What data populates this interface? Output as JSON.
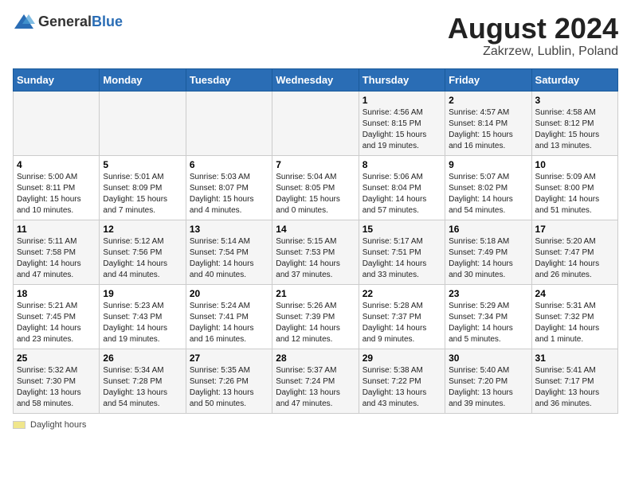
{
  "logo": {
    "general": "General",
    "blue": "Blue"
  },
  "title": "August 2024",
  "subtitle": "Zakrzew, Lublin, Poland",
  "days_of_week": [
    "Sunday",
    "Monday",
    "Tuesday",
    "Wednesday",
    "Thursday",
    "Friday",
    "Saturday"
  ],
  "legend_label": "Daylight hours",
  "weeks": [
    [
      {
        "day": "",
        "sunrise": "",
        "sunset": "",
        "daylight": ""
      },
      {
        "day": "",
        "sunrise": "",
        "sunset": "",
        "daylight": ""
      },
      {
        "day": "",
        "sunrise": "",
        "sunset": "",
        "daylight": ""
      },
      {
        "day": "",
        "sunrise": "",
        "sunset": "",
        "daylight": ""
      },
      {
        "day": "1",
        "sunrise": "Sunrise: 4:56 AM",
        "sunset": "Sunset: 8:15 PM",
        "daylight": "Daylight: 15 hours and 19 minutes."
      },
      {
        "day": "2",
        "sunrise": "Sunrise: 4:57 AM",
        "sunset": "Sunset: 8:14 PM",
        "daylight": "Daylight: 15 hours and 16 minutes."
      },
      {
        "day": "3",
        "sunrise": "Sunrise: 4:58 AM",
        "sunset": "Sunset: 8:12 PM",
        "daylight": "Daylight: 15 hours and 13 minutes."
      }
    ],
    [
      {
        "day": "4",
        "sunrise": "Sunrise: 5:00 AM",
        "sunset": "Sunset: 8:11 PM",
        "daylight": "Daylight: 15 hours and 10 minutes."
      },
      {
        "day": "5",
        "sunrise": "Sunrise: 5:01 AM",
        "sunset": "Sunset: 8:09 PM",
        "daylight": "Daylight: 15 hours and 7 minutes."
      },
      {
        "day": "6",
        "sunrise": "Sunrise: 5:03 AM",
        "sunset": "Sunset: 8:07 PM",
        "daylight": "Daylight: 15 hours and 4 minutes."
      },
      {
        "day": "7",
        "sunrise": "Sunrise: 5:04 AM",
        "sunset": "Sunset: 8:05 PM",
        "daylight": "Daylight: 15 hours and 0 minutes."
      },
      {
        "day": "8",
        "sunrise": "Sunrise: 5:06 AM",
        "sunset": "Sunset: 8:04 PM",
        "daylight": "Daylight: 14 hours and 57 minutes."
      },
      {
        "day": "9",
        "sunrise": "Sunrise: 5:07 AM",
        "sunset": "Sunset: 8:02 PM",
        "daylight": "Daylight: 14 hours and 54 minutes."
      },
      {
        "day": "10",
        "sunrise": "Sunrise: 5:09 AM",
        "sunset": "Sunset: 8:00 PM",
        "daylight": "Daylight: 14 hours and 51 minutes."
      }
    ],
    [
      {
        "day": "11",
        "sunrise": "Sunrise: 5:11 AM",
        "sunset": "Sunset: 7:58 PM",
        "daylight": "Daylight: 14 hours and 47 minutes."
      },
      {
        "day": "12",
        "sunrise": "Sunrise: 5:12 AM",
        "sunset": "Sunset: 7:56 PM",
        "daylight": "Daylight: 14 hours and 44 minutes."
      },
      {
        "day": "13",
        "sunrise": "Sunrise: 5:14 AM",
        "sunset": "Sunset: 7:54 PM",
        "daylight": "Daylight: 14 hours and 40 minutes."
      },
      {
        "day": "14",
        "sunrise": "Sunrise: 5:15 AM",
        "sunset": "Sunset: 7:53 PM",
        "daylight": "Daylight: 14 hours and 37 minutes."
      },
      {
        "day": "15",
        "sunrise": "Sunrise: 5:17 AM",
        "sunset": "Sunset: 7:51 PM",
        "daylight": "Daylight: 14 hours and 33 minutes."
      },
      {
        "day": "16",
        "sunrise": "Sunrise: 5:18 AM",
        "sunset": "Sunset: 7:49 PM",
        "daylight": "Daylight: 14 hours and 30 minutes."
      },
      {
        "day": "17",
        "sunrise": "Sunrise: 5:20 AM",
        "sunset": "Sunset: 7:47 PM",
        "daylight": "Daylight: 14 hours and 26 minutes."
      }
    ],
    [
      {
        "day": "18",
        "sunrise": "Sunrise: 5:21 AM",
        "sunset": "Sunset: 7:45 PM",
        "daylight": "Daylight: 14 hours and 23 minutes."
      },
      {
        "day": "19",
        "sunrise": "Sunrise: 5:23 AM",
        "sunset": "Sunset: 7:43 PM",
        "daylight": "Daylight: 14 hours and 19 minutes."
      },
      {
        "day": "20",
        "sunrise": "Sunrise: 5:24 AM",
        "sunset": "Sunset: 7:41 PM",
        "daylight": "Daylight: 14 hours and 16 minutes."
      },
      {
        "day": "21",
        "sunrise": "Sunrise: 5:26 AM",
        "sunset": "Sunset: 7:39 PM",
        "daylight": "Daylight: 14 hours and 12 minutes."
      },
      {
        "day": "22",
        "sunrise": "Sunrise: 5:28 AM",
        "sunset": "Sunset: 7:37 PM",
        "daylight": "Daylight: 14 hours and 9 minutes."
      },
      {
        "day": "23",
        "sunrise": "Sunrise: 5:29 AM",
        "sunset": "Sunset: 7:34 PM",
        "daylight": "Daylight: 14 hours and 5 minutes."
      },
      {
        "day": "24",
        "sunrise": "Sunrise: 5:31 AM",
        "sunset": "Sunset: 7:32 PM",
        "daylight": "Daylight: 14 hours and 1 minute."
      }
    ],
    [
      {
        "day": "25",
        "sunrise": "Sunrise: 5:32 AM",
        "sunset": "Sunset: 7:30 PM",
        "daylight": "Daylight: 13 hours and 58 minutes."
      },
      {
        "day": "26",
        "sunrise": "Sunrise: 5:34 AM",
        "sunset": "Sunset: 7:28 PM",
        "daylight": "Daylight: 13 hours and 54 minutes."
      },
      {
        "day": "27",
        "sunrise": "Sunrise: 5:35 AM",
        "sunset": "Sunset: 7:26 PM",
        "daylight": "Daylight: 13 hours and 50 minutes."
      },
      {
        "day": "28",
        "sunrise": "Sunrise: 5:37 AM",
        "sunset": "Sunset: 7:24 PM",
        "daylight": "Daylight: 13 hours and 47 minutes."
      },
      {
        "day": "29",
        "sunrise": "Sunrise: 5:38 AM",
        "sunset": "Sunset: 7:22 PM",
        "daylight": "Daylight: 13 hours and 43 minutes."
      },
      {
        "day": "30",
        "sunrise": "Sunrise: 5:40 AM",
        "sunset": "Sunset: 7:20 PM",
        "daylight": "Daylight: 13 hours and 39 minutes."
      },
      {
        "day": "31",
        "sunrise": "Sunrise: 5:41 AM",
        "sunset": "Sunset: 7:17 PM",
        "daylight": "Daylight: 13 hours and 36 minutes."
      }
    ]
  ]
}
